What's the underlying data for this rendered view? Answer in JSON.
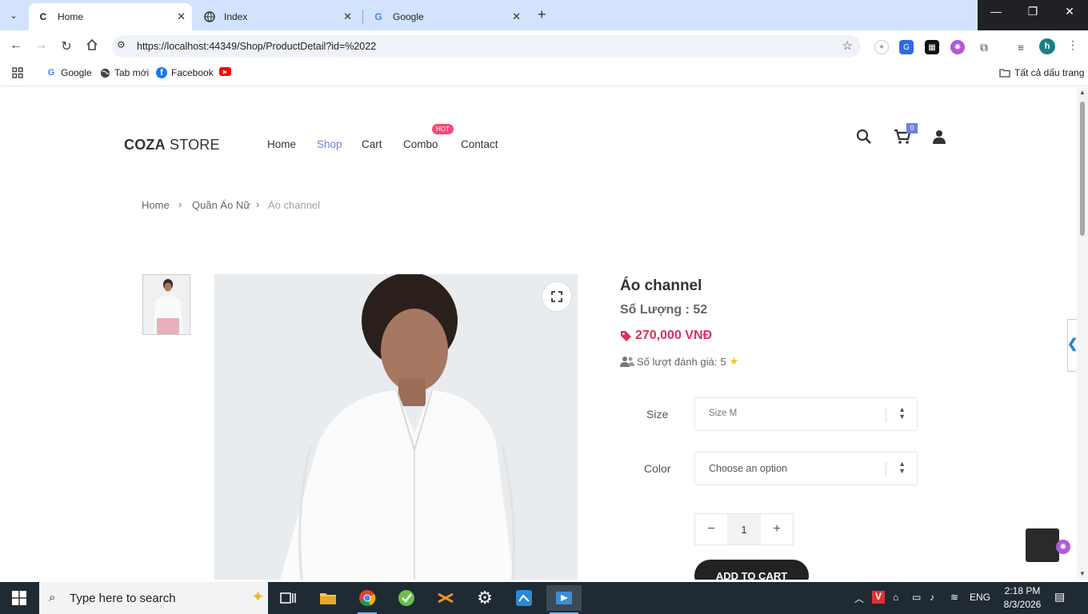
{
  "browser": {
    "tabs": [
      {
        "title": "Home",
        "favicon": "C"
      },
      {
        "title": "Index",
        "favicon": "globe"
      },
      {
        "title": "Google",
        "favicon": "G"
      }
    ],
    "url": "https://localhost:44349/Shop/ProductDetail?id=%2022",
    "bookmarks": [
      {
        "label": "Google"
      },
      {
        "label": "Tab mới"
      },
      {
        "label": "Facebook"
      }
    ],
    "all_bookmarks": "Tất cả dấu trang",
    "profile_initial": "h"
  },
  "site": {
    "logo_bold": "COZA",
    "logo_light": " STORE",
    "menu": [
      "Home",
      "Shop",
      "Cart",
      "Combo",
      "Contact"
    ],
    "active_menu": "Shop",
    "hot_badge": "HOT",
    "cart_count": "0",
    "accent": "#717fe0"
  },
  "breadcrumb": [
    "Home",
    "Quần Áo Nữ",
    "Áo channel"
  ],
  "product": {
    "name": "Áo channel",
    "quantity": "Số Lượng : 52",
    "price": "270,000 VNĐ",
    "rating_label": "Số lượt đánh giá:",
    "rating_value": "5",
    "size_label": "Size",
    "size_value": "Size M",
    "color_label": "Color",
    "color_value": "Choose an option",
    "qty": "1",
    "add_to_cart": "ADD TO CART",
    "price_color": "#d6335c"
  },
  "taskbar": {
    "search_placeholder": "Type here to search",
    "lang": "ENG",
    "time": "2:18 PM",
    "date": "8/3/2026"
  }
}
